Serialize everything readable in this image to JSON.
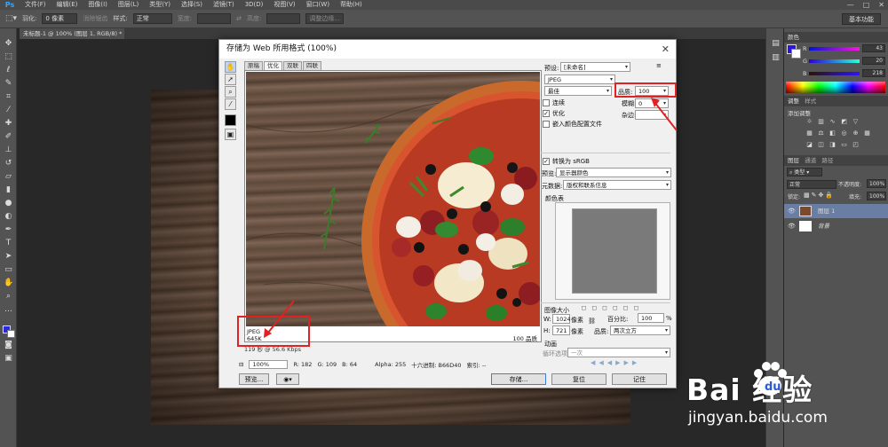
{
  "menubar": {
    "logo": "Ps",
    "items": [
      "文件(F)",
      "编辑(E)",
      "图像(I)",
      "图层(L)",
      "类型(Y)",
      "选择(S)",
      "滤镜(T)",
      "3D(D)",
      "视图(V)",
      "窗口(W)",
      "帮助(H)"
    ],
    "window_controls": [
      "—",
      "□",
      "✕"
    ]
  },
  "options": {
    "feather_label": "羽化:",
    "feather_value": "0 像素",
    "antialias": "消除锯齿",
    "style_label": "样式:",
    "style_value": "正常",
    "width_label": "宽度:",
    "height_label": "高度:",
    "refine_edge": "调整边缘...",
    "workspace": "基本功能"
  },
  "document_tab": "未标题-1 @ 100% (图层 1, RGB/8) *",
  "dialog": {
    "title": "存储为 Web 所用格式 (100%)",
    "close": "✕",
    "tabs": [
      "原稿",
      "优化",
      "双联",
      "四联"
    ],
    "preview_format": "JPEG",
    "preview_size": "645K",
    "preview_time": "119 秒 @ 56.6 Kbps",
    "preview_quality": "100 品质",
    "zoom": "100%",
    "readouts": {
      "r": "R: 182",
      "g": "G: 109",
      "b": "B: 64",
      "alpha": "Alpha: 255",
      "hex": "十六进制: B66D40",
      "index": "索引: --"
    },
    "buttons": {
      "preview": "预览...",
      "save": "存储...",
      "reset": "复位",
      "remember": "记住"
    },
    "settings": {
      "preset_label": "预设:",
      "preset_value": "[未命名]",
      "format_value": "JPEG",
      "quality_level": "最佳",
      "quality_label": "品质:",
      "quality_value": "100",
      "progressive": "连续",
      "blur_label": "模糊:",
      "blur_value": "0",
      "optimized": "优化",
      "matte_label": "杂边:",
      "embed_profile": "嵌入颜色配置文件",
      "convert_srgb": "转换为 sRGB",
      "preview_label": "预览:",
      "preview_value": "显示器颜色",
      "metadata_label": "元数据:",
      "metadata_value": "版权和联系信息",
      "color_table_label": "颜色表",
      "image_size_label": "图像大小",
      "w_label": "W:",
      "w_value": "1024",
      "h_label": "H:",
      "h_value": "721",
      "unit": "像素",
      "percent_label": "百分比:",
      "percent_value": "100",
      "percent_sign": "%",
      "quality2_label": "品质:",
      "quality2_value": "两次立方",
      "animation_label": "动画",
      "loop_label": "循环选项:",
      "loop_value": "一次"
    }
  },
  "panels": {
    "color": {
      "title": "颜色",
      "r_label": "R",
      "r_value": "43",
      "g_label": "G",
      "g_value": "20",
      "b_label": "B",
      "b_value": "218"
    },
    "adjustments": {
      "tab": "调整",
      "tab2": "样式",
      "subtitle": "添加调整"
    },
    "layers": {
      "tabs": [
        "图层",
        "通道",
        "路径"
      ],
      "filter": "类型",
      "blend_mode": "正常",
      "opacity_label": "不透明度:",
      "opacity_value": "100%",
      "lock_label": "锁定:",
      "fill_label": "填充:",
      "fill_value": "100%",
      "rows": [
        {
          "name": "图层 1"
        },
        {
          "name": "背景"
        }
      ]
    }
  },
  "watermark": {
    "brand": "Bai  经验",
    "url": "jingyan.baidu.com"
  },
  "colors": {
    "accent_red": "#e02222",
    "foreground": "#2b14da"
  }
}
